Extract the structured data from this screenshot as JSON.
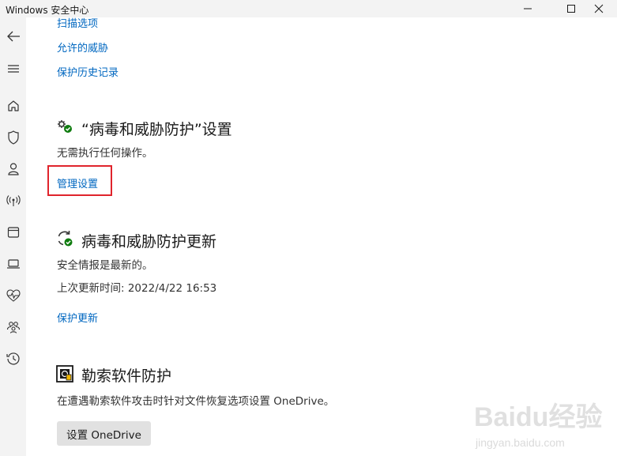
{
  "window": {
    "title": "Windows 安全中心"
  },
  "sidebar": {
    "items": [
      "back",
      "menu",
      "home",
      "virus-protection",
      "account-protection",
      "firewall",
      "app-browser-control",
      "device-security",
      "device-performance",
      "family-options",
      "protection-history"
    ]
  },
  "links": {
    "scan_options": "扫描选项",
    "allowed_threats": "允许的威胁",
    "protection_history": "保护历史记录"
  },
  "settings_section": {
    "title": "“病毒和威胁防护”设置",
    "status": "无需执行任何操作。",
    "manage_link": "管理设置"
  },
  "updates_section": {
    "title": "病毒和威胁防护更新",
    "status": "安全情报是最新的。",
    "last_update": "上次更新时间: 2022/4/22 16:53",
    "update_link": "保护更新"
  },
  "ransomware_section": {
    "title": "勒索软件防护",
    "description": "在遭遇勒索软件攻击时针对文件恢复选项设置 OneDrive。",
    "button": "设置 OneDrive"
  },
  "watermark": {
    "line1": "Baidu经验",
    "line2": "jingyan.baidu.com"
  },
  "colors": {
    "link": "#0067c0",
    "highlight": "#e0242c",
    "sidebar": "#f3f3f3"
  }
}
